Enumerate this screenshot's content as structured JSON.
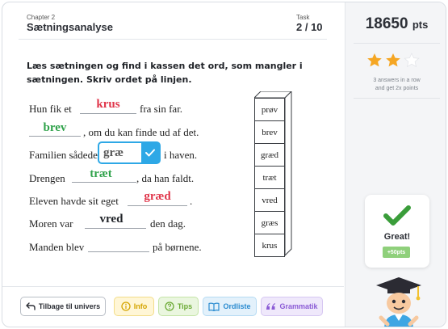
{
  "header": {
    "chapter_label": "Chapter 2",
    "chapter_title": "Sætningsanalyse",
    "task_label": "Task",
    "task_progress": "2 / 10"
  },
  "instruction": "Læs sætningen og find i kassen det ord, som mangler i sætningen. Skriv ordet på linjen.",
  "sentences": [
    {
      "before": "Hun fik et",
      "answer": "krus",
      "status": "wrong",
      "after": "fra sin far."
    },
    {
      "before": "",
      "answer": "brev",
      "status": "correct",
      "after": ", om du kan finde ud af det."
    },
    {
      "before": "Familien sådede",
      "answer": "",
      "status": "active",
      "after": "i haven."
    },
    {
      "before": "Drengen",
      "answer": "træt",
      "status": "correct",
      "after": ", da han faldt."
    },
    {
      "before": "Eleven havde sit eget",
      "answer": "græd",
      "status": "wrong",
      "after": "."
    },
    {
      "before": "Moren var",
      "answer": "vred",
      "status": "pending",
      "after": "den dag."
    },
    {
      "before": "Manden blev",
      "answer": "",
      "status": "empty",
      "after": "på børnene."
    }
  ],
  "active_input": {
    "value": "græ"
  },
  "word_box": [
    "prøv",
    "brev",
    "græd",
    "træt",
    "vred",
    "græs",
    "krus"
  ],
  "score": {
    "value": "18650",
    "unit": "pts"
  },
  "stars": {
    "filled": 2,
    "total": 3
  },
  "streak_text_1": "3 answers in a row",
  "streak_text_2": "and get 2x points",
  "feedback": {
    "title": "Great!",
    "bonus": "+50pts"
  },
  "toolbar": {
    "back": "Tilbage til univers",
    "info": "Info",
    "tips": "Tips",
    "ordliste": "Ordliste",
    "grammatik": "Grammatik"
  },
  "colors": {
    "wrong": "#e0354a",
    "correct": "#2fa24a",
    "accent": "#2ea8e6",
    "star": "#f5a623"
  }
}
